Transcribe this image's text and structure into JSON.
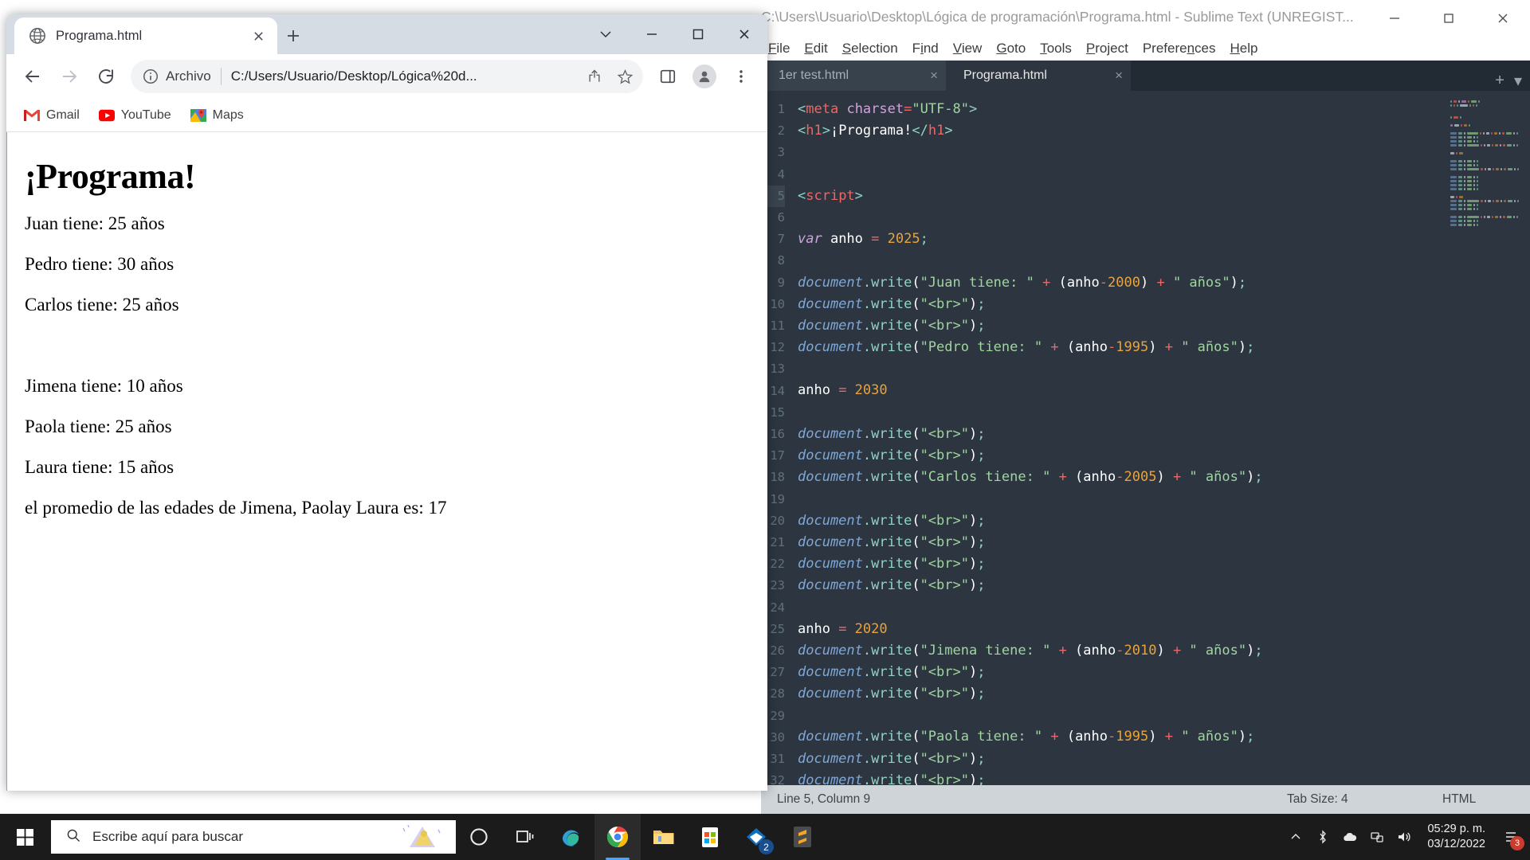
{
  "browser": {
    "tab": {
      "title": "Programa.html",
      "favicon": "globe-icon",
      "close": "×"
    },
    "newtab_label": "+",
    "window_controls": {
      "minimize": "–",
      "maximize": "□",
      "close": "×",
      "chevron": "⌄"
    },
    "toolbar": {
      "back": "back-arrow",
      "forward": "forward-arrow",
      "reload": "reload-icon",
      "scheme_label": "Archivo",
      "url": "C:/Users/Usuario/Desktop/Lógica%20d...",
      "share": "share-icon",
      "bookmark": "star-icon",
      "sidepanel": "side-panel-icon",
      "profile": "avatar-icon",
      "menu": "three-dot-menu-icon"
    },
    "bookmarks": [
      {
        "label": "Gmail",
        "icon": "gmail-icon"
      },
      {
        "label": "YouTube",
        "icon": "youtube-icon"
      },
      {
        "label": "Maps",
        "icon": "google-maps-icon"
      }
    ],
    "page": {
      "heading": "¡Programa!",
      "lines": [
        "Juan tiene: 25 años",
        "Pedro tiene: 30 años",
        "Carlos tiene: 25 años",
        "",
        "Jimena tiene: 10 años",
        "Paola tiene: 25 años",
        "Laura tiene: 15 años",
        "el promedio de las edades de Jimena, Paolay Laura es: 17"
      ]
    }
  },
  "sublime": {
    "title": "C:\\Users\\Usuario\\Desktop\\Lógica de programación\\Programa.html - Sublime Text (UNREGIST...",
    "window_controls": {
      "minimize": "–",
      "maximize": "□",
      "close": "×"
    },
    "menus": [
      "File",
      "Edit",
      "Selection",
      "Find",
      "View",
      "Goto",
      "Tools",
      "Project",
      "Preferences",
      "Help"
    ],
    "tabs": [
      {
        "label": "1er test.html",
        "active": false,
        "close": "×"
      },
      {
        "label": "Programa.html",
        "active": true,
        "close": "×"
      }
    ],
    "tabbar_actions": {
      "add": "+",
      "overflow": "▾"
    },
    "gutter_start_line": 1,
    "highlighted_line": 5,
    "code": [
      {
        "n": 1,
        "tokens": [
          [
            "t-punc",
            "<"
          ],
          [
            "t-tag",
            "meta"
          ],
          [
            "t-plain",
            " "
          ],
          [
            "t-attr",
            "charset"
          ],
          [
            "t-op",
            "="
          ],
          [
            "t-str",
            "\"UTF-8\""
          ],
          [
            "t-punc",
            ">"
          ]
        ]
      },
      {
        "n": 2,
        "tokens": [
          [
            "t-punc",
            "<"
          ],
          [
            "t-tag",
            "h1"
          ],
          [
            "t-punc",
            ">"
          ],
          [
            "t-plain",
            "¡Programa!"
          ],
          [
            "t-punc",
            "</"
          ],
          [
            "t-tag",
            "h1"
          ],
          [
            "t-punc",
            ">"
          ]
        ]
      },
      {
        "n": 3,
        "tokens": []
      },
      {
        "n": 4,
        "tokens": []
      },
      {
        "n": 5,
        "tokens": [
          [
            "t-punc",
            "<"
          ],
          [
            "t-tag",
            "script"
          ],
          [
            "t-punc",
            ">"
          ]
        ]
      },
      {
        "n": 6,
        "tokens": []
      },
      {
        "n": 7,
        "tokens": [
          [
            "t-kw",
            "var"
          ],
          [
            "t-var",
            " anho "
          ],
          [
            "t-op",
            "="
          ],
          [
            "t-num",
            " 2025"
          ],
          [
            "t-punc",
            ";"
          ]
        ]
      },
      {
        "n": 8,
        "tokens": []
      },
      {
        "n": 9,
        "tokens": [
          [
            "t-obj",
            "document"
          ],
          [
            "t-fn",
            ".write"
          ],
          [
            "t-paren",
            "("
          ],
          [
            "t-str",
            "\"Juan tiene: \""
          ],
          [
            "t-op",
            " + "
          ],
          [
            "t-paren",
            "("
          ],
          [
            "t-var",
            "anho"
          ],
          [
            "t-op",
            "-"
          ],
          [
            "t-num",
            "2000"
          ],
          [
            "t-paren",
            ")"
          ],
          [
            "t-op",
            " + "
          ],
          [
            "t-str",
            "\" años\""
          ],
          [
            "t-paren",
            ")"
          ],
          [
            "t-punc",
            ";"
          ]
        ]
      },
      {
        "n": 10,
        "tokens": [
          [
            "t-obj",
            "document"
          ],
          [
            "t-fn",
            ".write"
          ],
          [
            "t-paren",
            "("
          ],
          [
            "t-str",
            "\"<br>\""
          ],
          [
            "t-paren",
            ")"
          ],
          [
            "t-punc",
            ";"
          ]
        ]
      },
      {
        "n": 11,
        "tokens": [
          [
            "t-obj",
            "document"
          ],
          [
            "t-fn",
            ".write"
          ],
          [
            "t-paren",
            "("
          ],
          [
            "t-str",
            "\"<br>\""
          ],
          [
            "t-paren",
            ")"
          ],
          [
            "t-punc",
            ";"
          ]
        ]
      },
      {
        "n": 12,
        "tokens": [
          [
            "t-obj",
            "document"
          ],
          [
            "t-fn",
            ".write"
          ],
          [
            "t-paren",
            "("
          ],
          [
            "t-str",
            "\"Pedro tiene: \""
          ],
          [
            "t-op",
            " + "
          ],
          [
            "t-paren",
            "("
          ],
          [
            "t-var",
            "anho"
          ],
          [
            "t-op",
            "-"
          ],
          [
            "t-num",
            "1995"
          ],
          [
            "t-paren",
            ")"
          ],
          [
            "t-op",
            " + "
          ],
          [
            "t-str",
            "\" años\""
          ],
          [
            "t-paren",
            ")"
          ],
          [
            "t-punc",
            ";"
          ]
        ]
      },
      {
        "n": 13,
        "tokens": []
      },
      {
        "n": 14,
        "tokens": [
          [
            "t-var",
            "anho "
          ],
          [
            "t-op",
            "="
          ],
          [
            "t-num",
            " 2030"
          ]
        ]
      },
      {
        "n": 15,
        "tokens": []
      },
      {
        "n": 16,
        "tokens": [
          [
            "t-obj",
            "document"
          ],
          [
            "t-fn",
            ".write"
          ],
          [
            "t-paren",
            "("
          ],
          [
            "t-str",
            "\"<br>\""
          ],
          [
            "t-paren",
            ")"
          ],
          [
            "t-punc",
            ";"
          ]
        ]
      },
      {
        "n": 17,
        "tokens": [
          [
            "t-obj",
            "document"
          ],
          [
            "t-fn",
            ".write"
          ],
          [
            "t-paren",
            "("
          ],
          [
            "t-str",
            "\"<br>\""
          ],
          [
            "t-paren",
            ")"
          ],
          [
            "t-punc",
            ";"
          ]
        ]
      },
      {
        "n": 18,
        "tokens": [
          [
            "t-obj",
            "document"
          ],
          [
            "t-fn",
            ".write"
          ],
          [
            "t-paren",
            "("
          ],
          [
            "t-str",
            "\"Carlos tiene: \""
          ],
          [
            "t-op",
            " + "
          ],
          [
            "t-paren",
            "("
          ],
          [
            "t-var",
            "anho"
          ],
          [
            "t-op",
            "-"
          ],
          [
            "t-num",
            "2005"
          ],
          [
            "t-paren",
            ")"
          ],
          [
            "t-op",
            " + "
          ],
          [
            "t-str",
            "\" años\""
          ],
          [
            "t-paren",
            ")"
          ],
          [
            "t-punc",
            ";"
          ]
        ]
      },
      {
        "n": 19,
        "tokens": []
      },
      {
        "n": 20,
        "tokens": [
          [
            "t-obj",
            "document"
          ],
          [
            "t-fn",
            ".write"
          ],
          [
            "t-paren",
            "("
          ],
          [
            "t-str",
            "\"<br>\""
          ],
          [
            "t-paren",
            ")"
          ],
          [
            "t-punc",
            ";"
          ]
        ]
      },
      {
        "n": 21,
        "tokens": [
          [
            "t-obj",
            "document"
          ],
          [
            "t-fn",
            ".write"
          ],
          [
            "t-paren",
            "("
          ],
          [
            "t-str",
            "\"<br>\""
          ],
          [
            "t-paren",
            ")"
          ],
          [
            "t-punc",
            ";"
          ]
        ]
      },
      {
        "n": 22,
        "tokens": [
          [
            "t-obj",
            "document"
          ],
          [
            "t-fn",
            ".write"
          ],
          [
            "t-paren",
            "("
          ],
          [
            "t-str",
            "\"<br>\""
          ],
          [
            "t-paren",
            ")"
          ],
          [
            "t-punc",
            ";"
          ]
        ]
      },
      {
        "n": 23,
        "tokens": [
          [
            "t-obj",
            "document"
          ],
          [
            "t-fn",
            ".write"
          ],
          [
            "t-paren",
            "("
          ],
          [
            "t-str",
            "\"<br>\""
          ],
          [
            "t-paren",
            ")"
          ],
          [
            "t-punc",
            ";"
          ]
        ]
      },
      {
        "n": 24,
        "tokens": []
      },
      {
        "n": 25,
        "tokens": [
          [
            "t-var",
            "anho "
          ],
          [
            "t-op",
            "="
          ],
          [
            "t-num",
            " 2020"
          ]
        ]
      },
      {
        "n": 26,
        "tokens": [
          [
            "t-obj",
            "document"
          ],
          [
            "t-fn",
            ".write"
          ],
          [
            "t-paren",
            "("
          ],
          [
            "t-str",
            "\"Jimena tiene: \""
          ],
          [
            "t-op",
            " + "
          ],
          [
            "t-paren",
            "("
          ],
          [
            "t-var",
            "anho"
          ],
          [
            "t-op",
            "-"
          ],
          [
            "t-num",
            "2010"
          ],
          [
            "t-paren",
            ")"
          ],
          [
            "t-op",
            " + "
          ],
          [
            "t-str",
            "\" años\""
          ],
          [
            "t-paren",
            ")"
          ],
          [
            "t-punc",
            ";"
          ]
        ]
      },
      {
        "n": 27,
        "tokens": [
          [
            "t-obj",
            "document"
          ],
          [
            "t-fn",
            ".write"
          ],
          [
            "t-paren",
            "("
          ],
          [
            "t-str",
            "\"<br>\""
          ],
          [
            "t-paren",
            ")"
          ],
          [
            "t-punc",
            ";"
          ]
        ]
      },
      {
        "n": 28,
        "tokens": [
          [
            "t-obj",
            "document"
          ],
          [
            "t-fn",
            ".write"
          ],
          [
            "t-paren",
            "("
          ],
          [
            "t-str",
            "\"<br>\""
          ],
          [
            "t-paren",
            ")"
          ],
          [
            "t-punc",
            ";"
          ]
        ]
      },
      {
        "n": 29,
        "tokens": []
      },
      {
        "n": 30,
        "tokens": [
          [
            "t-obj",
            "document"
          ],
          [
            "t-fn",
            ".write"
          ],
          [
            "t-paren",
            "("
          ],
          [
            "t-str",
            "\"Paola tiene: \""
          ],
          [
            "t-op",
            " + "
          ],
          [
            "t-paren",
            "("
          ],
          [
            "t-var",
            "anho"
          ],
          [
            "t-op",
            "-"
          ],
          [
            "t-num",
            "1995"
          ],
          [
            "t-paren",
            ")"
          ],
          [
            "t-op",
            " + "
          ],
          [
            "t-str",
            "\" años\""
          ],
          [
            "t-paren",
            ")"
          ],
          [
            "t-punc",
            ";"
          ]
        ]
      },
      {
        "n": 31,
        "tokens": [
          [
            "t-obj",
            "document"
          ],
          [
            "t-fn",
            ".write"
          ],
          [
            "t-paren",
            "("
          ],
          [
            "t-str",
            "\"<br>\""
          ],
          [
            "t-paren",
            ")"
          ],
          [
            "t-punc",
            ";"
          ]
        ]
      },
      {
        "n": 32,
        "tokens": [
          [
            "t-obj",
            "document"
          ],
          [
            "t-fn",
            ".write"
          ],
          [
            "t-paren",
            "("
          ],
          [
            "t-str",
            "\"<br>\""
          ],
          [
            "t-paren",
            ")"
          ],
          [
            "t-punc",
            ";"
          ]
        ]
      }
    ],
    "status": {
      "cursor": "Line 5, Column 9",
      "tab_size": "Tab Size: 4",
      "syntax": "HTML"
    }
  },
  "taskbar": {
    "start": "windows-start-icon",
    "search_placeholder": "Escribe aquí para buscar",
    "apps": [
      {
        "name": "cortana-icon",
        "badge": ""
      },
      {
        "name": "task-view-icon",
        "badge": ""
      },
      {
        "name": "edge-icon",
        "badge": ""
      },
      {
        "name": "chrome-icon",
        "badge": ""
      },
      {
        "name": "file-explorer-icon",
        "badge": ""
      },
      {
        "name": "microsoft-store-icon",
        "badge": ""
      },
      {
        "name": "mail-icon",
        "badge": "2"
      },
      {
        "name": "sublime-text-icon",
        "badge": ""
      }
    ],
    "tray": {
      "chevron": "^",
      "time": "05:29 p. m.",
      "date": "03/12/2022",
      "notif_count": "3"
    }
  },
  "colors": {
    "sublime_bg": "#2d3640",
    "sublime_tabbar": "#222a33",
    "chrome_frame": "#d6dce3",
    "taskbar": "#1b1b1b",
    "accent_string": "#9fd59f",
    "accent_number": "#e8a33d",
    "accent_tag": "#ec6767"
  }
}
